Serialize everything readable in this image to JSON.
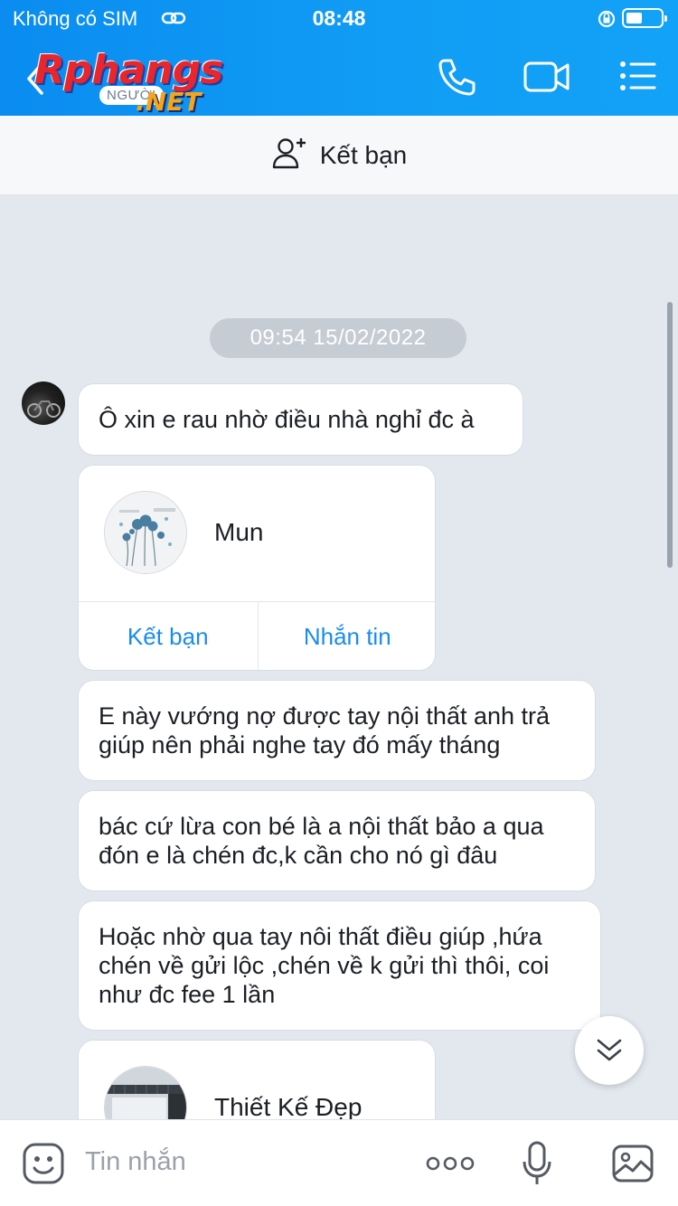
{
  "status_bar": {
    "carrier": "Không có SIM",
    "time": "08:48"
  },
  "header": {
    "logo_brand": "Rphangs",
    "logo_sub": "NGƯỜI",
    "logo_net": ".NET",
    "icons": [
      "back-icon",
      "phone-icon",
      "video-call-icon",
      "menu-icon"
    ]
  },
  "friend_bar": {
    "label": "Kết bạn",
    "icon": "add-user-icon"
  },
  "chat": {
    "date": "09:54 15/02/2022",
    "messages": [
      {
        "type": "text",
        "lines": [
          "Ô xin e rau nhờ điều nhà nghỉ đc à"
        ]
      },
      {
        "type": "contact",
        "name": "Mun",
        "add_friend": "Kết bạn",
        "message": "Nhắn tin"
      },
      {
        "type": "text",
        "lines": [
          "E này vướng nợ được tay nội thất anh trả",
          "giúp nên phải nghe tay đó mấy tháng"
        ]
      },
      {
        "type": "text",
        "lines": [
          "bác cứ lừa con bé là a nội thất bảo a qua",
          "đón e là chén đc,k cần cho nó gì đâu"
        ]
      },
      {
        "type": "text",
        "lines": [
          "Hoặc nhờ qua tay nôi thất điều giúp ,hứa",
          "chén về gửi lộc ,chén về k gửi thì thôi, coi",
          "như đc fee 1 lần"
        ]
      },
      {
        "type": "contact",
        "name": "Thiết Kế Đẹp"
      }
    ]
  },
  "input_bar": {
    "placeholder": "Tin nhắn",
    "icons": [
      "emoji-icon",
      "more-icon",
      "microphone-icon",
      "image-icon"
    ]
  },
  "colors": {
    "header": "#119df5",
    "accent": "#1a8cf0",
    "background": "#e3e8ef"
  }
}
